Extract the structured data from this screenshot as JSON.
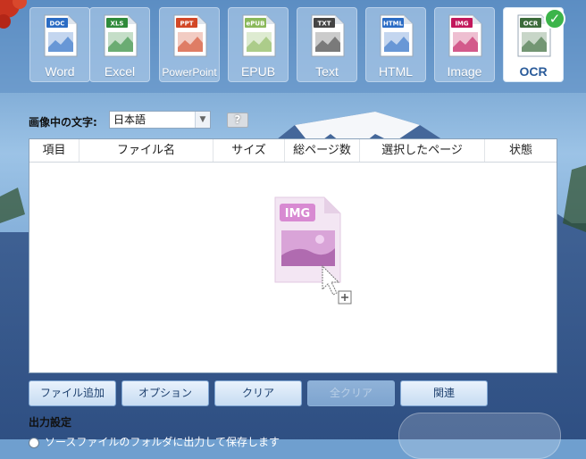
{
  "formats": [
    {
      "label": "Word",
      "badge": "DOC",
      "color": "#2b6cc4"
    },
    {
      "label": "Excel",
      "badge": "XLS",
      "color": "#2f8a3a"
    },
    {
      "label": "PowerPoint",
      "badge": "PPT",
      "color": "#d24726"
    },
    {
      "label": "EPUB",
      "badge": "ePUB",
      "color": "#8ab85a"
    },
    {
      "label": "Text",
      "badge": "TXT",
      "color": "#444444"
    },
    {
      "label": "HTML",
      "badge": "HTML",
      "color": "#2b6cc4"
    },
    {
      "label": "Image",
      "badge": "IMG",
      "color": "#c2185b"
    },
    {
      "label": "OCR",
      "badge": "OCR",
      "color": "#3b6b3a"
    }
  ],
  "active_format": "OCR",
  "language": {
    "label": "画像中の文字:",
    "value": "日本語",
    "help": "?"
  },
  "table": {
    "columns": [
      "項目",
      "ファイル名",
      "サイズ",
      "総ページ数",
      "選択したページ",
      "状態"
    ],
    "drop_badge": "IMG"
  },
  "buttons": {
    "add_file": "ファイル追加",
    "options": "オプション",
    "clear": "クリア",
    "clear_all": "全クリア",
    "related": "関連"
  },
  "output": {
    "label": "出力設定",
    "option_text": "ソースファイルのフォルダに出力して保存します"
  },
  "colors": {
    "accent": "#2a5b9a",
    "button_text": "#1c3f6e",
    "check_green": "#3cb44a"
  }
}
